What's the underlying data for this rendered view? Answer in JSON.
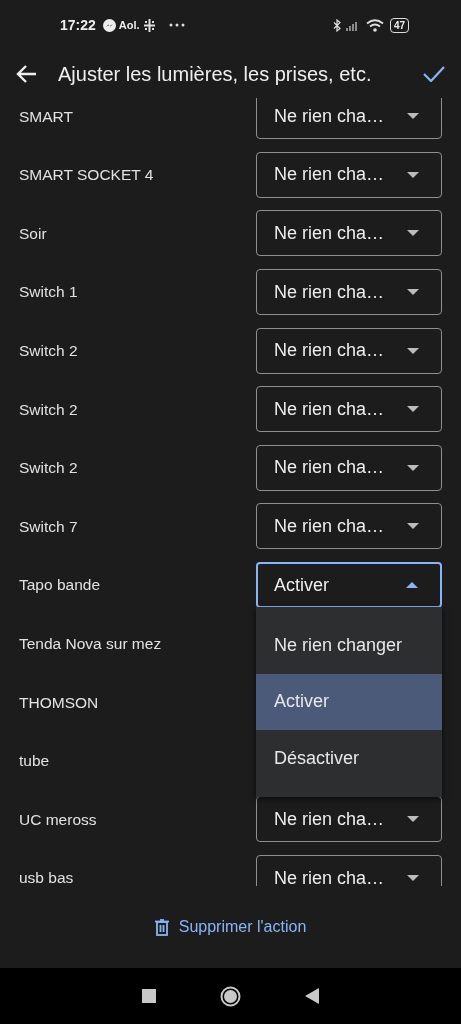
{
  "status_bar": {
    "time": "17:22",
    "app_label": "Aol.",
    "battery": "47"
  },
  "toolbar": {
    "title": "Ajuster les lumières, les prises, etc."
  },
  "devices": [
    {
      "name": "SMART",
      "value": "Ne rien cha…",
      "expanded": false
    },
    {
      "name": "SMART SOCKET 4",
      "value": "Ne rien cha…",
      "expanded": false
    },
    {
      "name": "Soir",
      "value": "Ne rien cha…",
      "expanded": false
    },
    {
      "name": "Switch 1",
      "value": "Ne rien cha…",
      "expanded": false
    },
    {
      "name": "Switch 2",
      "value": "Ne rien cha…",
      "expanded": false
    },
    {
      "name": "Switch 2",
      "value": "Ne rien cha…",
      "expanded": false
    },
    {
      "name": "Switch 2",
      "value": "Ne rien cha…",
      "expanded": false
    },
    {
      "name": "Switch 7",
      "value": "Ne rien cha…",
      "expanded": false
    },
    {
      "name": "Tapo bande",
      "value": "Activer",
      "expanded": true
    },
    {
      "name": "Tenda Nova sur mez"
    },
    {
      "name": "THOMSON"
    },
    {
      "name": "tube"
    },
    {
      "name": "UC meross",
      "value": "Ne rien cha…",
      "expanded": false
    },
    {
      "name": "usb bas",
      "value": "Ne rien cha…",
      "expanded": false
    }
  ],
  "menu": {
    "options": [
      {
        "label": "Ne rien changer",
        "selected": false
      },
      {
        "label": "Activer",
        "selected": true
      },
      {
        "label": "Désactiver",
        "selected": false
      }
    ]
  },
  "delete_button": {
    "label": "Supprimer l'action"
  }
}
